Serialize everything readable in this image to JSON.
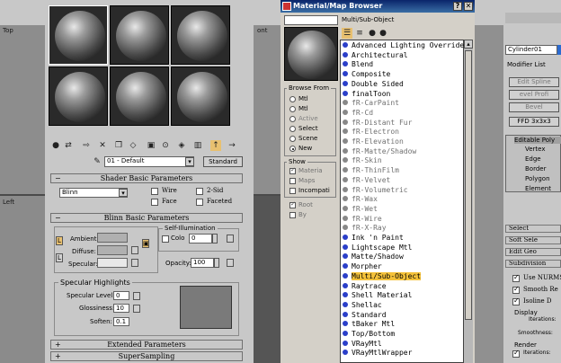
{
  "viewports": {
    "top_label": "Top",
    "front_label": "ont",
    "left_label": "Left"
  },
  "material_editor": {
    "material_name": "01 - Default",
    "material_type": "Standard",
    "rollouts": {
      "shader_basic": "Shader Basic Parameters",
      "blinn_basic": "Blinn Basic Parameters",
      "extended": "Extended Parameters",
      "supersampling": "SuperSampling"
    },
    "shader": {
      "value": "Blinn",
      "wire": "Wire",
      "two_sided": "2-Sid",
      "face_map": "Face",
      "faceted": "Faceted"
    },
    "colors": {
      "ambient": "Ambient:",
      "diffuse": "Diffuse:",
      "specular": "Specular:"
    },
    "self_illum": {
      "title": "Self-Illumination",
      "color_label": "Colo",
      "value": "0"
    },
    "opacity": {
      "label": "Opacity:",
      "value": "100"
    },
    "highlights": {
      "title": "Specular Highlights",
      "specular_level_label": "Specular Level:",
      "specular_level_value": "0",
      "glossiness_label": "Glossiness:",
      "glossiness_value": "10",
      "soften_label": "Soften:",
      "soften_value": "0.1"
    }
  },
  "browser": {
    "title": "Material/Map Browser",
    "breadcrumb": "Multi/Sub-Object",
    "browse_from": {
      "title": "Browse From",
      "options": [
        "Mtl",
        "Mtl",
        "Active",
        "Select",
        "Scene",
        "New"
      ]
    },
    "show": {
      "title": "Show",
      "materials": "Materia",
      "maps": "Maps",
      "incompatible": "Incompati",
      "root": "Root",
      "by": "By"
    },
    "items": [
      {
        "label": "Advanced Lighting Override",
        "dis": false
      },
      {
        "label": "Architectural",
        "dis": false
      },
      {
        "label": "Blend",
        "dis": false
      },
      {
        "label": "Composite",
        "dis": false
      },
      {
        "label": "Double Sided",
        "dis": false
      },
      {
        "label": "finalToon",
        "dis": false
      },
      {
        "label": "fR-CarPaint",
        "dis": true
      },
      {
        "label": "fR-Cd",
        "dis": true
      },
      {
        "label": "fR-Distant Fur",
        "dis": true
      },
      {
        "label": "fR-Electron",
        "dis": true
      },
      {
        "label": "fR-Elevation",
        "dis": true
      },
      {
        "label": "fR-Matte/Shadow",
        "dis": true
      },
      {
        "label": "fR-Skin",
        "dis": true
      },
      {
        "label": "fR-ThinFilm",
        "dis": true
      },
      {
        "label": "fR-Velvet",
        "dis": true
      },
      {
        "label": "fR-Volumetric",
        "dis": true
      },
      {
        "label": "fR-Wax",
        "dis": true
      },
      {
        "label": "fR-Wet",
        "dis": true
      },
      {
        "label": "fR-Wire",
        "dis": true
      },
      {
        "label": "fR-X-Ray",
        "dis": true
      },
      {
        "label": "Ink 'n Paint",
        "dis": false
      },
      {
        "label": "Lightscape Mtl",
        "dis": false
      },
      {
        "label": "Matte/Shadow",
        "dis": false
      },
      {
        "label": "Morpher",
        "dis": false
      },
      {
        "label": "Multi/Sub-Object",
        "dis": false,
        "sel": true
      },
      {
        "label": "Raytrace",
        "dis": false
      },
      {
        "label": "Shell Material",
        "dis": false
      },
      {
        "label": "Shellac",
        "dis": false
      },
      {
        "label": "Standard",
        "dis": false
      },
      {
        "label": "tBaker Mtl",
        "dis": false
      },
      {
        "label": "Top/Bottom",
        "dis": false
      },
      {
        "label": "VRayMtl",
        "dis": false
      },
      {
        "label": "VRayMtlWrapper",
        "dis": false
      }
    ]
  },
  "command_panel": {
    "object_name": "Cylinder01",
    "modifier_list": "Modifier List",
    "buttons": [
      "Edit Spline",
      "evel Profi",
      "Bevel",
      "FFD 3x3x3"
    ],
    "stack_top": "Editable Poly",
    "stack_items": [
      "Vertex",
      "Edge",
      "Border",
      "Polygon",
      "Element"
    ],
    "rollouts": [
      "Select",
      "Soft Sele",
      "Edit Geo",
      "Subdivision"
    ],
    "use_nurms": "Use NURMS",
    "smooth_result": "Smooth Re",
    "isoline": "Isoline D",
    "display": "Display",
    "iterations_1": "Iterations:",
    "smoothness": "Smoothness:",
    "render": "Render",
    "iterations_2": "Iterations:"
  }
}
